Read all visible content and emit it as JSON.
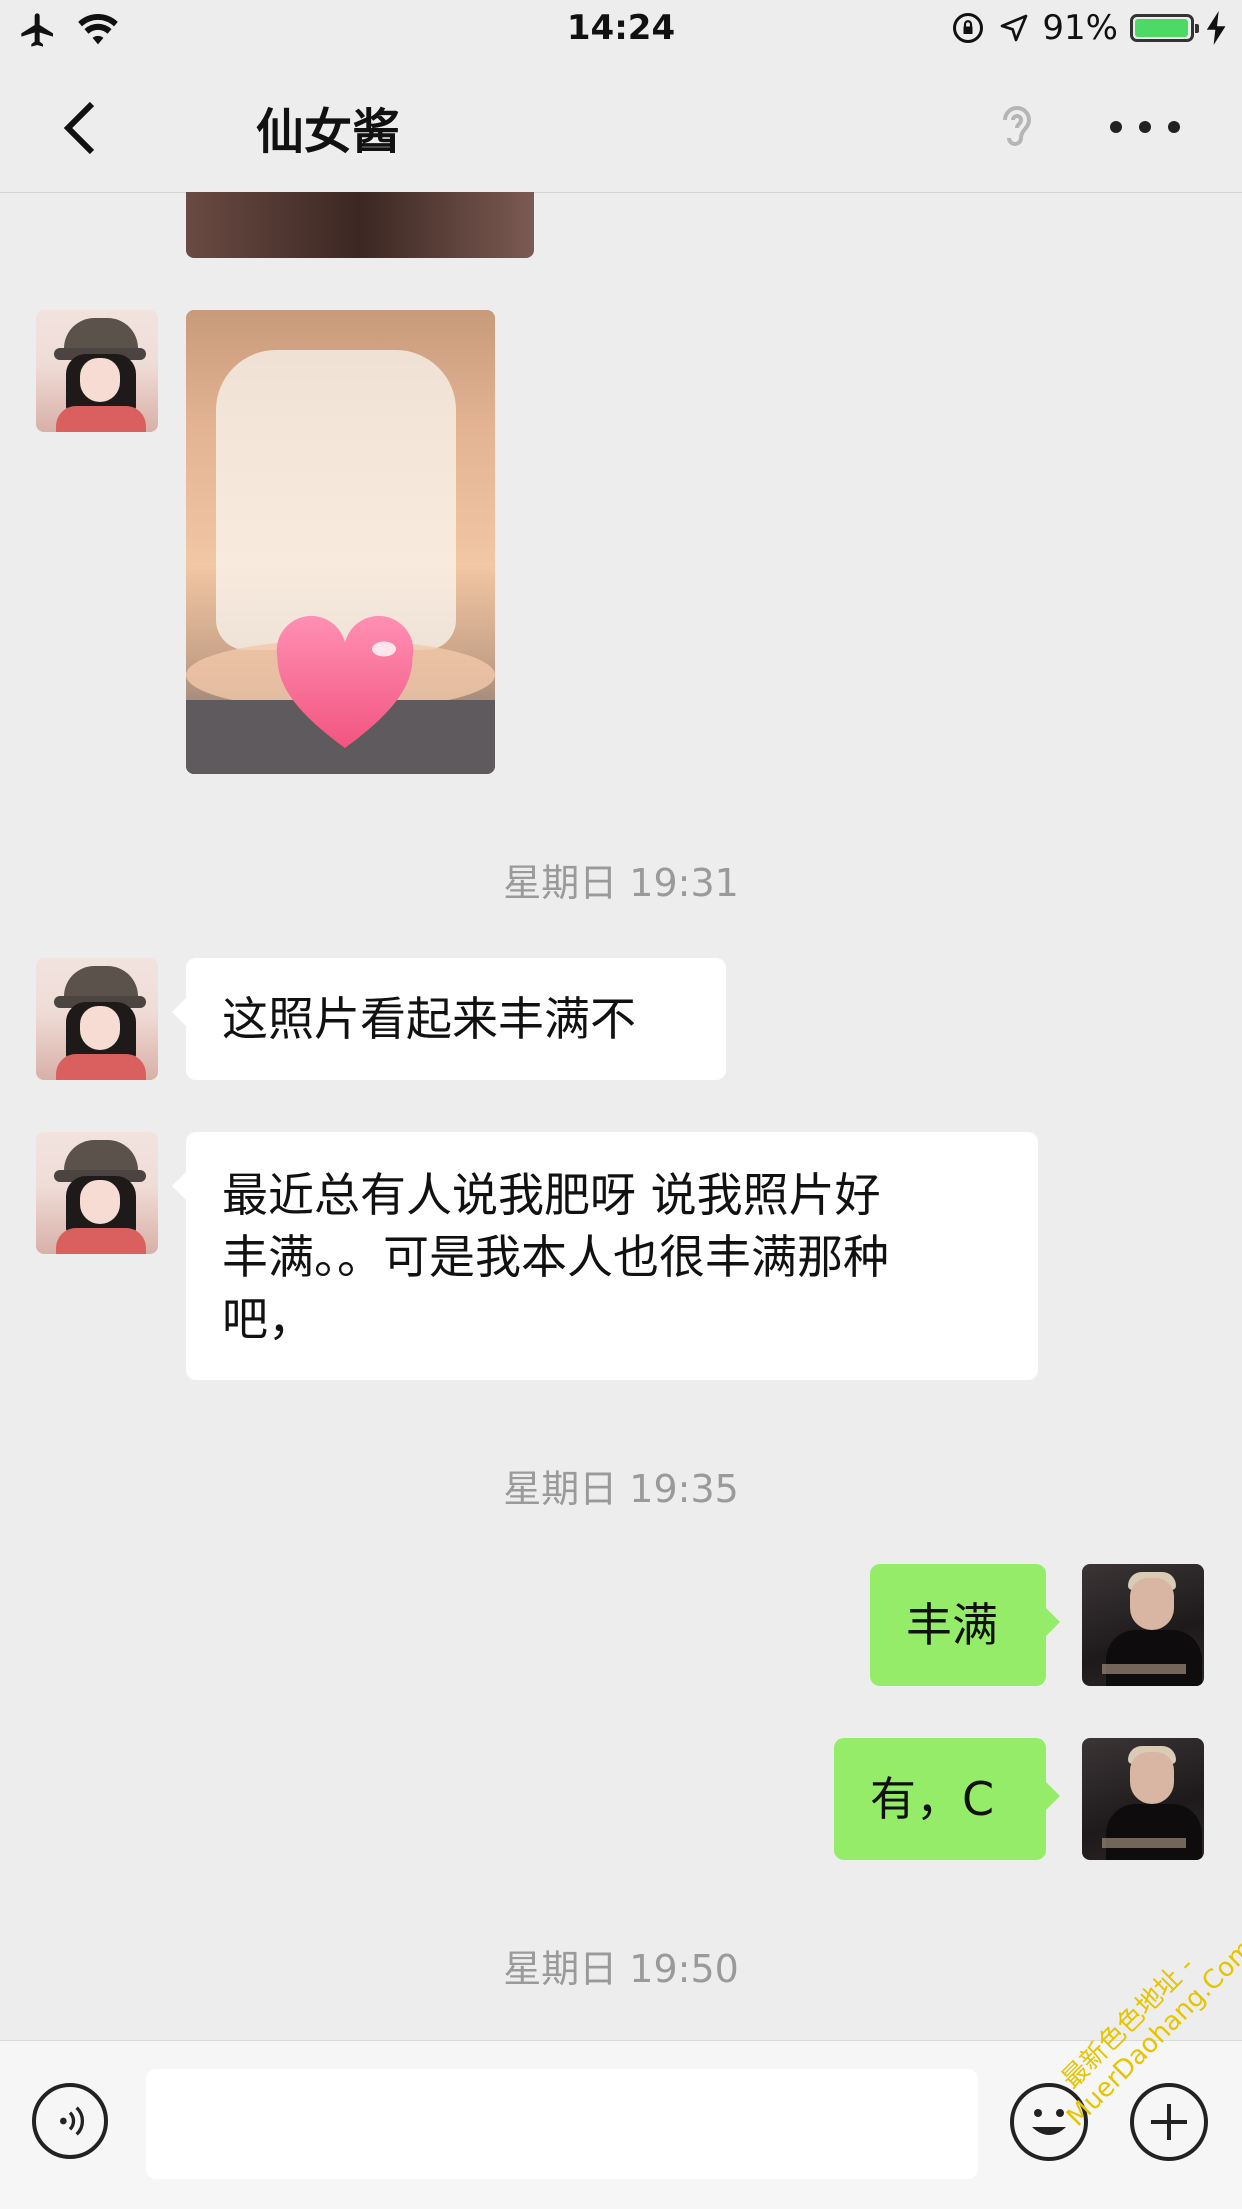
{
  "status_bar": {
    "time": "14:24",
    "battery_text": "91%",
    "battery_level": 0.91,
    "battery_color": "#4cd964"
  },
  "nav": {
    "title": "仙女酱"
  },
  "timestamps": [
    "星期日 19:31",
    "星期日 19:35",
    "星期日 19:50"
  ],
  "messages": [
    {
      "side": "in",
      "text": "这照片看起来丰满不"
    },
    {
      "side": "in",
      "lines": [
        "最近总有人说我肥呀 说我照片好",
        "丰满。。可是我本人也很丰满那种",
        "吧，"
      ]
    },
    {
      "side": "out",
      "text": "丰满"
    },
    {
      "side": "out",
      "text": "有，C"
    }
  ],
  "composer": {
    "placeholder": ""
  },
  "watermark": {
    "lines": [
      "最新色色地址 -",
      "MuerDaohang.Com"
    ]
  },
  "colors": {
    "background": "#ededed",
    "outgoing_bubble": "#95ec69",
    "incoming_bubble": "#ffffff",
    "timestamp": "#9a9a9a"
  },
  "icons": [
    "airplane-icon",
    "wifi-icon",
    "rotation-lock-icon",
    "location-arrow-icon",
    "battery-icon",
    "charging-bolt-icon",
    "back-chevron-icon",
    "ear-icon",
    "more-icon",
    "voice-icon",
    "emoji-icon",
    "plus-icon",
    "heart-icon"
  ]
}
